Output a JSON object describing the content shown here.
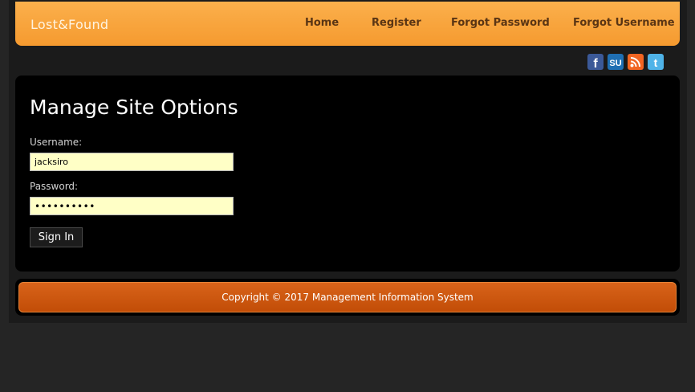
{
  "header": {
    "logo": "Lost&Found",
    "nav": [
      "Home",
      "Register",
      "Forgot Password",
      "Forgot Username"
    ]
  },
  "social": {
    "icons": [
      "facebook-icon",
      "stumbleupon-icon",
      "rss-icon",
      "twitter-icon"
    ],
    "colors": {
      "facebook": "#3b5998",
      "stumbleupon": "#1f6fb3",
      "rss": "#f26522",
      "twitter": "#4fb3e8"
    }
  },
  "form": {
    "title": "Manage Site Options",
    "username_label": "Username:",
    "username_value": "jacksiro",
    "password_label": "Password:",
    "password_value": "••••••••••",
    "submit_label": "Sign In"
  },
  "footer": {
    "copyright": "Copyright © 2017 Management Information System"
  },
  "colors": {
    "accent_orange": "#f7a03a",
    "footer_orange": "#c9550c",
    "input_bg": "#ffffc6"
  }
}
